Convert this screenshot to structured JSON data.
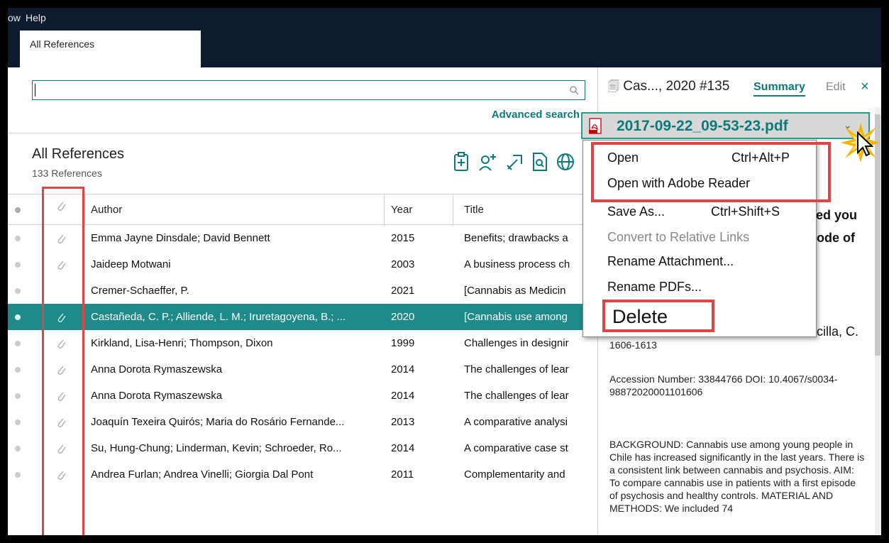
{
  "menubar": {
    "items": [
      "ow",
      "Help"
    ]
  },
  "tab": {
    "label": "All References"
  },
  "search": {
    "placeholder": "",
    "advanced_label": "Advanced search"
  },
  "library": {
    "title": "All References",
    "count": "133 References"
  },
  "toolbar": {
    "icons": [
      "add-reference-icon",
      "share-user-icon",
      "export-icon",
      "find-fulltext-icon",
      "online-search-icon"
    ]
  },
  "table": {
    "headers": {
      "author": "Author",
      "year": "Year",
      "title": "Title"
    },
    "rows": [
      {
        "author": "Emma Jayne Dinsdale; David Bennett",
        "year": "2015",
        "title": "Benefits; drawbacks a",
        "clip": true
      },
      {
        "author": "Jaideep Motwani",
        "year": "2003",
        "title": "A business process ch",
        "clip": true
      },
      {
        "author": "Cremer-Schaeffer, P.",
        "year": "2021",
        "title": "[Cannabis as Medicin",
        "clip": false
      },
      {
        "author": "Castañeda, C. P.; Alliende, L. M.; Iruretagoyena, B.; ...",
        "year": "2020",
        "title": "[Cannabis use among",
        "clip": true,
        "selected": true
      },
      {
        "author": "Kirkland, Lisa-Henri; Thompson, Dixon",
        "year": "1999",
        "title": "Challenges in designir",
        "clip": true
      },
      {
        "author": "Anna Dorota Rymaszewska",
        "year": "2014",
        "title": "The challenges of lear",
        "clip": true
      },
      {
        "author": "Anna Dorota Rymaszewska",
        "year": "2014",
        "title": "The challenges of lear",
        "clip": true
      },
      {
        "author": "Joaquín Texeira Quirós; Maria do Rosário Fernande...",
        "year": "2013",
        "title": "A comparative analysi",
        "clip": true
      },
      {
        "author": "Su, Hung-Chung; Linderman, Kevin; Schroeder, Ro...",
        "year": "2014",
        "title": "A comparative case st",
        "clip": true
      },
      {
        "author": "Andrea Furlan; Andrea Vinelli; Giorgia Dal Pont",
        "year": "2011",
        "title": "Complementarity and",
        "clip": true
      }
    ]
  },
  "panel": {
    "title": "Cas..., 2020 #135",
    "summary_tab": "Summary",
    "edit_tab": "Edit",
    "close": "×",
    "frag1": "zed you",
    "frag2": "sode of",
    "frag3": "ncilla, C.",
    "pages": "1606-1613",
    "accession": "Accession Number: 33844766 DOI: 10.4067/s0034-98872020001101606",
    "abstract": "BACKGROUND: Cannabis use among young people in Chile has increased significantly in the last years. There is a consistent link between cannabis and psychosis. AIM: To compare cannabis use in patients with a first episode of psychosis and healthy controls. MATERIAL AND METHODS: We included 74"
  },
  "attachment": {
    "filename": "2017-09-22_09-53-23.pdf",
    "menu": {
      "open": "Open",
      "open_shortcut": "Ctrl+Alt+P",
      "open_with": "Open with Adobe Reader",
      "save_as": "Save As...",
      "save_as_shortcut": "Ctrl+Shift+S",
      "convert": "Convert to Relative Links",
      "rename_attachment": "Rename Attachment...",
      "rename_pdfs": "Rename PDFs...",
      "delete": "Delete"
    }
  },
  "colors": {
    "accent": "#1f8a8a",
    "highlight": "#e04545",
    "titlebar": "#0e1a2e"
  }
}
